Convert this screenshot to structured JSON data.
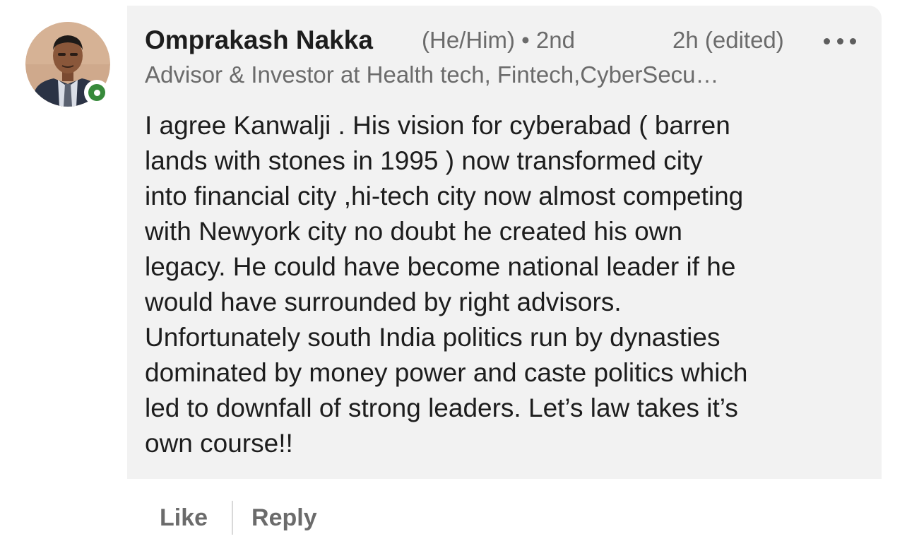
{
  "author": {
    "name": "Omprakash Nakka",
    "pronouns_degree": "(He/Him) • 2nd",
    "headline": "Advisor & Investor at Health tech, Fintech,CyberSecu…",
    "online_status_color": "#378a3b"
  },
  "comment": {
    "timestamp": "2h (edited)",
    "text": "I agree Kanwalji . His vision for cyberabad ( barren\nlands with stones in 1995 ) now transformed city\ninto financial city ,hi-tech city now almost competing\nwith Newyork city no doubt he created  his own\nlegacy. He could have become national leader if he\nwould have surrounded by right advisors.\nUnfortunately south India politics run by dynasties\ndominated by money power and caste politics which\nled to downfall of strong leaders. Let’s law takes it’s\nown course!!"
  },
  "actions": {
    "like_label": "Like",
    "reply_label": "Reply"
  },
  "icons": {
    "more": "more-options-icon"
  }
}
